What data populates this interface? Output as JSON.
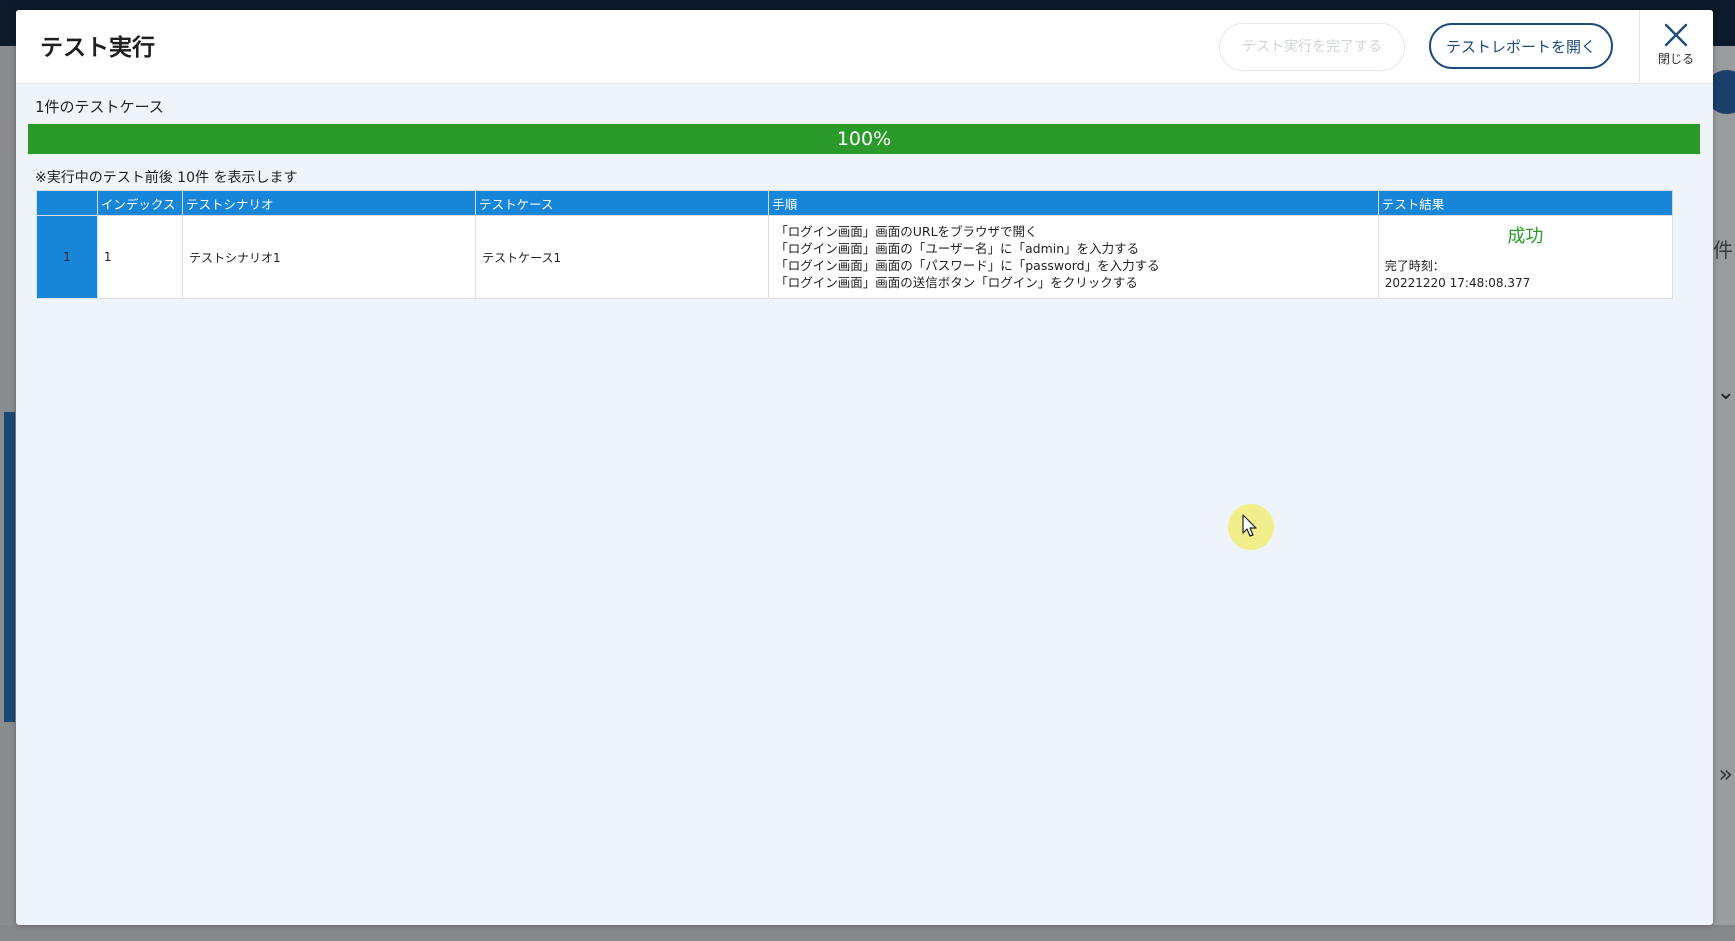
{
  "modal": {
    "title": "テスト実行",
    "complete_button": "テスト実行を完了する",
    "report_button": "テストレポートを開く",
    "close_label": "閉じる"
  },
  "summary": {
    "case_count": "1件のテストケース",
    "progress_percent": 100,
    "progress_label": "100%",
    "note": "※実行中のテスト前後 10件 を表示します"
  },
  "table": {
    "columns": [
      "",
      "インデックス",
      "テストシナリオ",
      "テストケース",
      "手順",
      "テスト結果"
    ],
    "rows": [
      {
        "row_number": "1",
        "index": "1",
        "scenario": "テストシナリオ1",
        "test_case": "テストケース1",
        "steps": [
          "「ログイン画面」画面のURLをブラウザで開く",
          "「ログイン画面」画面の「ユーザー名」に「admin」を入力する",
          "「ログイン画面」画面の「パスワード」に「password」を入力する",
          "「ログイン画面」画面の送信ボタン「ログイン」をクリックする"
        ],
        "result_status": "成功",
        "completed_label": "完了時刻：",
        "completed_time": "20221220 17:48:08.377"
      }
    ]
  },
  "background": {
    "right_text": "件"
  },
  "colors": {
    "accent": "#1e4c7c",
    "table_header": "#1786d8",
    "progress": "#2a9a2a",
    "success": "#2a9a2a"
  },
  "icons": [
    "close-icon",
    "cursor-icon"
  ]
}
